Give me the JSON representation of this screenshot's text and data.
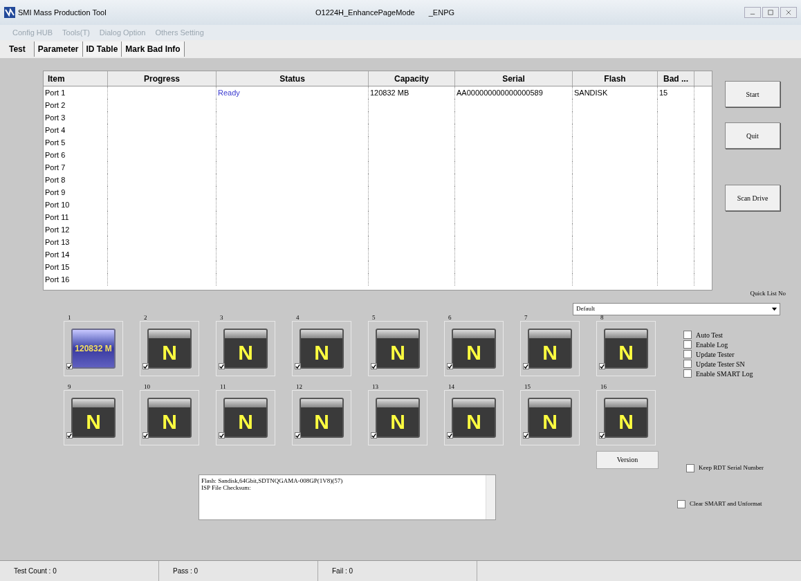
{
  "window": {
    "title": "SMI Mass Production Tool",
    "subtitle": "O1224H_EnhancePageMode",
    "mode": "_ENPG"
  },
  "menu": [
    "Config HUB",
    "Tools(T)",
    "Dialog Option",
    "Others Setting"
  ],
  "tabs": [
    {
      "label": "Test",
      "selected": true
    },
    {
      "label": "Parameter",
      "selected": false
    },
    {
      "label": "ID Table",
      "selected": false
    },
    {
      "label": "Mark Bad Info",
      "selected": false
    }
  ],
  "table": {
    "columns": [
      "Item",
      "Progress",
      "Status",
      "Capacity",
      "Serial",
      "Flash",
      "Bad ..."
    ],
    "rows": [
      {
        "item": "Port 1",
        "status": "Ready",
        "capacity": "120832 MB",
        "serial": "AA000000000000000589",
        "flash": "SANDISK",
        "bad": "15"
      },
      {
        "item": "Port 2"
      },
      {
        "item": "Port 3"
      },
      {
        "item": "Port 4"
      },
      {
        "item": "Port 5"
      },
      {
        "item": "Port 6"
      },
      {
        "item": "Port 7"
      },
      {
        "item": "Port 8"
      },
      {
        "item": "Port 9"
      },
      {
        "item": "Port 10"
      },
      {
        "item": "Port 11"
      },
      {
        "item": "Port 12"
      },
      {
        "item": "Port 13"
      },
      {
        "item": "Port 14"
      },
      {
        "item": "Port 15"
      },
      {
        "item": "Port 16"
      }
    ]
  },
  "buttons": [
    "Start",
    "Quit",
    "Scan Drive"
  ],
  "quick_list": {
    "label": "Quick List No",
    "value": "Default"
  },
  "ports": [
    {
      "number": "1",
      "kind": "capacity",
      "label": "120832 M",
      "checked": true
    },
    {
      "number": "2",
      "kind": "empty",
      "label": "N",
      "checked": true
    },
    {
      "number": "3",
      "kind": "empty",
      "label": "N",
      "checked": true
    },
    {
      "number": "4",
      "kind": "empty",
      "label": "N",
      "checked": true
    },
    {
      "number": "5",
      "kind": "empty",
      "label": "N",
      "checked": true
    },
    {
      "number": "6",
      "kind": "empty",
      "label": "N",
      "checked": true
    },
    {
      "number": "7",
      "kind": "empty",
      "label": "N",
      "checked": true
    },
    {
      "number": "8",
      "kind": "empty",
      "label": "N",
      "checked": true
    },
    {
      "number": "9",
      "kind": "empty",
      "label": "N",
      "checked": true
    },
    {
      "number": "10",
      "kind": "empty",
      "label": "N",
      "checked": true
    },
    {
      "number": "11",
      "kind": "empty",
      "label": "N",
      "checked": true
    },
    {
      "number": "12",
      "kind": "empty",
      "label": "N",
      "checked": true
    },
    {
      "number": "13",
      "kind": "empty",
      "label": "N",
      "checked": true
    },
    {
      "number": "14",
      "kind": "empty",
      "label": "N",
      "checked": true
    },
    {
      "number": "15",
      "kind": "empty",
      "label": "N",
      "checked": true
    },
    {
      "number": "16",
      "kind": "empty",
      "label": "N",
      "checked": true
    }
  ],
  "options": [
    {
      "label": "Auto Test",
      "checked": false
    },
    {
      "label": "Enable Log",
      "checked": false
    },
    {
      "label": "Update Tester",
      "checked": false
    },
    {
      "label": "Update Tester SN",
      "checked": false
    },
    {
      "label": "Enable SMART Log",
      "checked": false
    }
  ],
  "version_button": "Version",
  "keep_rdt": {
    "label": "Keep RDT Serial Number",
    "checked": false
  },
  "clear_smart": {
    "label": "Clear SMART and Unformat",
    "checked": false
  },
  "log": [
    "Flash: Sandisk,64Gbit,SDTNQGAMA-008GP(1V8)(57)",
    "ISP File Checksum:"
  ],
  "status_bar": [
    "Test Count : 0",
    "Pass : 0",
    "Fail : 0"
  ]
}
